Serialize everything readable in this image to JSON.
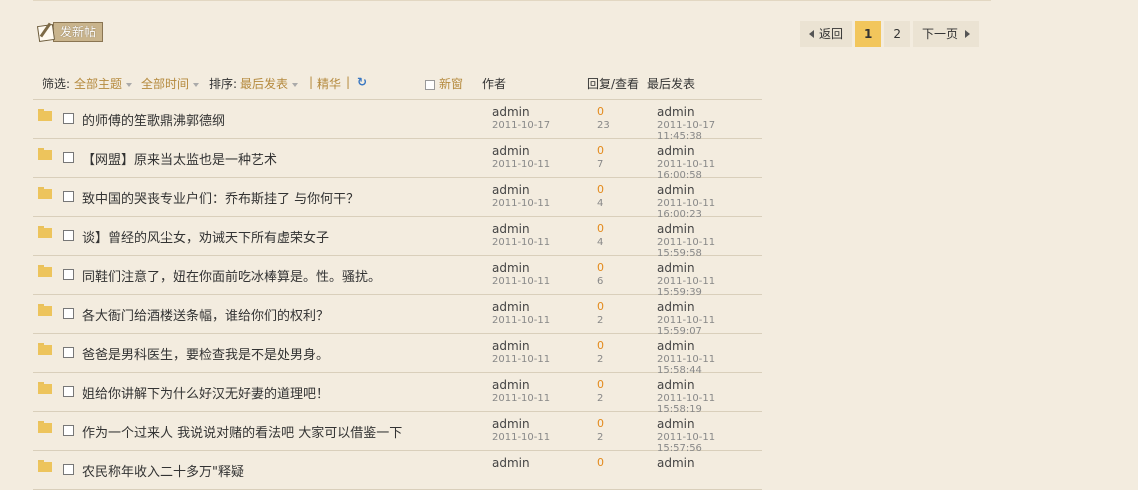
{
  "toolbar": {
    "new_post_label": "发新帖"
  },
  "pager": {
    "prev": "返回",
    "pages": [
      "1",
      "2"
    ],
    "current": "1",
    "next": "下一页"
  },
  "filter": {
    "label": "筛选:",
    "all_topics": "全部主题",
    "all_time": "全部时间",
    "sort_label": "排序:",
    "sort_value": "最后发表",
    "sep": "|",
    "digest": "精华",
    "refresh_icon": "↻",
    "new_window": "新窗",
    "col_author": "作者",
    "col_reply_view": "回复/查看",
    "col_last_post": "最后发表"
  },
  "threads": [
    {
      "title": "的师傅的笙歌鼎沸郭德纲",
      "author": "admin",
      "date": "2011-10-17",
      "replies": "0",
      "views": "23",
      "last_user": "admin",
      "last_time": "2011-10-17 11:45:38"
    },
    {
      "title": "【网盟】原来当太监也是一种艺术",
      "author": "admin",
      "date": "2011-10-11",
      "replies": "0",
      "views": "7",
      "last_user": "admin",
      "last_time": "2011-10-11 16:00:58"
    },
    {
      "title": "致中国的哭丧专业户们：乔布斯挂了 与你何干？",
      "author": "admin",
      "date": "2011-10-11",
      "replies": "0",
      "views": "4",
      "last_user": "admin",
      "last_time": "2011-10-11 16:00:23"
    },
    {
      "title": "谈】曾经的风尘女，劝诫天下所有虚荣女子",
      "author": "admin",
      "date": "2011-10-11",
      "replies": "0",
      "views": "4",
      "last_user": "admin",
      "last_time": "2011-10-11 15:59:58"
    },
    {
      "title": "同鞋们注意了，妞在你面前吃冰棒算是。性。骚扰。",
      "author": "admin",
      "date": "2011-10-11",
      "replies": "0",
      "views": "6",
      "last_user": "admin",
      "last_time": "2011-10-11 15:59:39"
    },
    {
      "title": "各大衙门给酒楼送条幅，谁给你们的权利？",
      "author": "admin",
      "date": "2011-10-11",
      "replies": "0",
      "views": "2",
      "last_user": "admin",
      "last_time": "2011-10-11 15:59:07"
    },
    {
      "title": "爸爸是男科医生，要检查我是不是处男身。",
      "author": "admin",
      "date": "2011-10-11",
      "replies": "0",
      "views": "2",
      "last_user": "admin",
      "last_time": "2011-10-11 15:58:44"
    },
    {
      "title": "姐给你讲解下为什么好汉无好妻的道理吧！",
      "author": "admin",
      "date": "2011-10-11",
      "replies": "0",
      "views": "2",
      "last_user": "admin",
      "last_time": "2011-10-11 15:58:19"
    },
    {
      "title": "作为一个过来人 我说说对赌的看法吧 大家可以借鉴一下",
      "author": "admin",
      "date": "2011-10-11",
      "replies": "0",
      "views": "2",
      "last_user": "admin",
      "last_time": "2011-10-11 15:57:56"
    },
    {
      "title": "农民称年收入二十多万\"释疑",
      "author": "admin",
      "date": "",
      "replies": "0",
      "views": "",
      "last_user": "admin",
      "last_time": ""
    }
  ]
}
